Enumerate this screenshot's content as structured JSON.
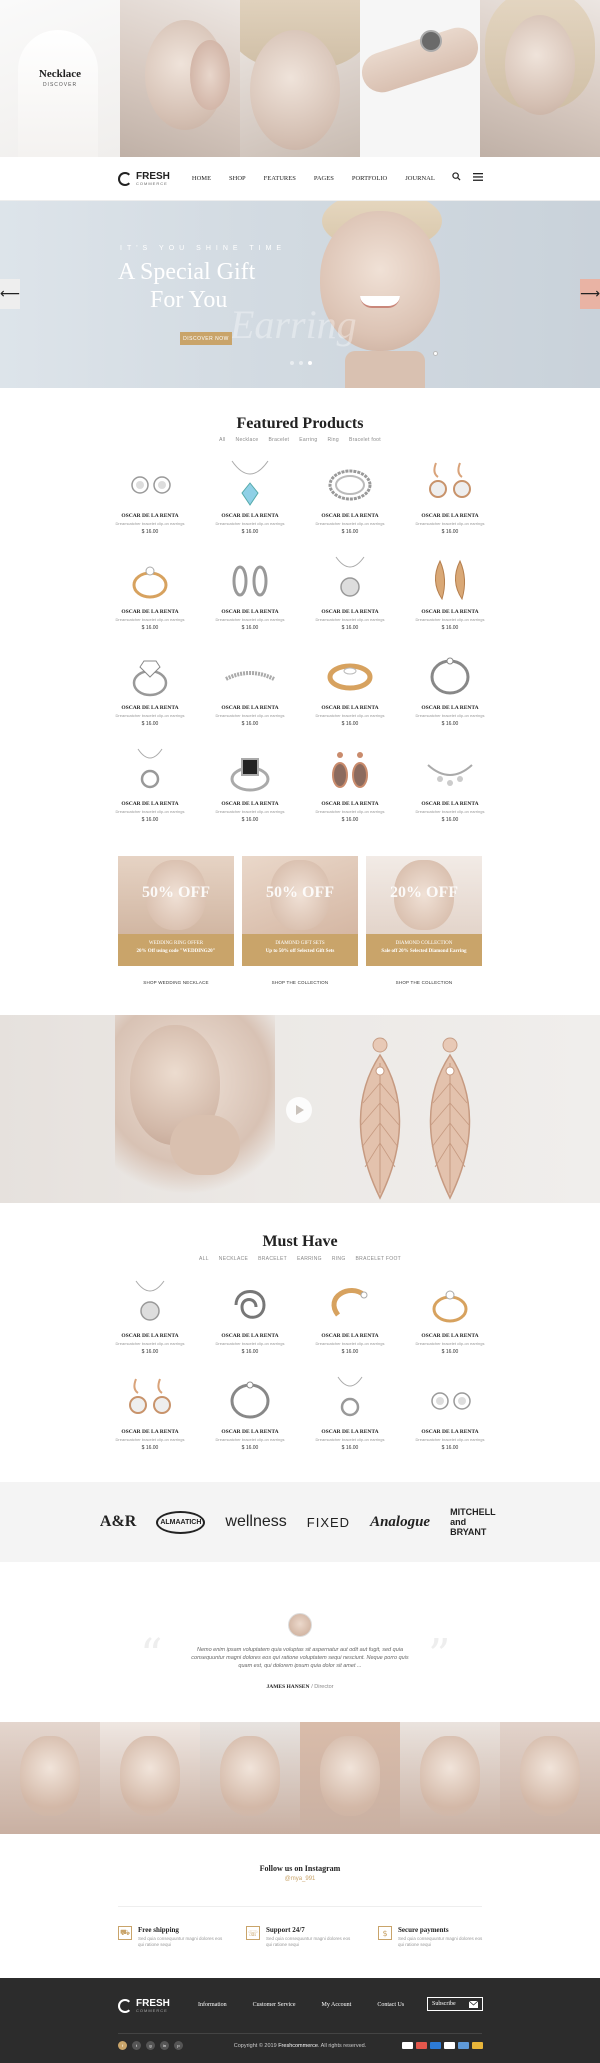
{
  "hero_strip": {
    "caption_title": "Necklace",
    "caption_sub": "DISCOVER"
  },
  "header": {
    "logo_main": "FRESH",
    "logo_sub": "COMMERCE",
    "nav": [
      "HOME",
      "SHOP",
      "FEATURES",
      "PAGES",
      "PORTFOLIO",
      "JOURNAL"
    ]
  },
  "slider": {
    "eyebrow": "IT'S YOU SHINE TIME",
    "title_line1": "A Special Gift",
    "title_line2": "For You",
    "watermark": "Earring",
    "cta": "DISCOVER NOW",
    "prev_arrow": "⟵",
    "next_arrow": "⟶"
  },
  "featured": {
    "title": "Featured Products",
    "tabs": [
      "All",
      "Necklace",
      "Bracelet",
      "Earring",
      "Ring",
      "Bracelet foot"
    ],
    "products": [
      {
        "name": "OSCAR DE LA RENTA",
        "desc": "Dreamcatcher bracelet clip-on earrings",
        "price": "$ 16.00",
        "icon": "stud-earrings-icon"
      },
      {
        "name": "OSCAR DE LA RENTA",
        "desc": "Dreamcatcher bracelet clip-on earrings",
        "price": "$ 16.00",
        "icon": "blue-pendant-icon"
      },
      {
        "name": "OSCAR DE LA RENTA",
        "desc": "Dreamcatcher bracelet clip-on earrings",
        "price": "$ 16.00",
        "icon": "chain-bracelet-icon"
      },
      {
        "name": "OSCAR DE LA RENTA",
        "desc": "Dreamcatcher bracelet clip-on earrings",
        "price": "$ 16.00",
        "icon": "drop-earrings-icon"
      },
      {
        "name": "OSCAR DE LA RENTA",
        "desc": "Dreamcatcher bracelet clip-on earrings",
        "price": "$ 16.00",
        "icon": "gold-ring-icon"
      },
      {
        "name": "OSCAR DE LA RENTA",
        "desc": "Dreamcatcher bracelet clip-on earrings",
        "price": "$ 16.00",
        "icon": "hoop-earrings-icon"
      },
      {
        "name": "OSCAR DE LA RENTA",
        "desc": "Dreamcatcher bracelet clip-on earrings",
        "price": "$ 16.00",
        "icon": "silver-pendant-icon"
      },
      {
        "name": "OSCAR DE LA RENTA",
        "desc": "Dreamcatcher bracelet clip-on earrings",
        "price": "$ 16.00",
        "icon": "leaf-earrings-icon"
      },
      {
        "name": "OSCAR DE LA RENTA",
        "desc": "Dreamcatcher bracelet clip-on earrings",
        "price": "$ 16.00",
        "icon": "diamond-ring-icon"
      },
      {
        "name": "OSCAR DE LA RENTA",
        "desc": "Dreamcatcher bracelet clip-on earrings",
        "price": "$ 16.00",
        "icon": "tennis-bracelet-icon"
      },
      {
        "name": "OSCAR DE LA RENTA",
        "desc": "Dreamcatcher bracelet clip-on earrings",
        "price": "$ 16.00",
        "icon": "gold-band-ring-icon"
      },
      {
        "name": "OSCAR DE LA RENTA",
        "desc": "Dreamcatcher bracelet clip-on earrings",
        "price": "$ 16.00",
        "icon": "bangle-icon"
      },
      {
        "name": "OSCAR DE LA RENTA",
        "desc": "Dreamcatcher bracelet clip-on earrings",
        "price": "$ 16.00",
        "icon": "circle-pendant-icon"
      },
      {
        "name": "OSCAR DE LA RENTA",
        "desc": "Dreamcatcher bracelet clip-on earrings",
        "price": "$ 16.00",
        "icon": "black-stone-ring-icon"
      },
      {
        "name": "OSCAR DE LA RENTA",
        "desc": "Dreamcatcher bracelet clip-on earrings",
        "price": "$ 16.00",
        "icon": "rose-drop-earrings-icon"
      },
      {
        "name": "OSCAR DE LA RENTA",
        "desc": "Dreamcatcher bracelet clip-on earrings",
        "price": "$ 16.00",
        "icon": "charm-bracelet-icon"
      }
    ]
  },
  "banners": [
    {
      "off": "50% OFF",
      "line1": "WEDDING RING OFFER",
      "line2": "20% Off using code \"WEDDING20\"",
      "link": "SHOP WEDDING NECKLACE"
    },
    {
      "off": "50% OFF",
      "line1": "DIAMOND GIFT SETS",
      "line2": "Up to 50% off Selected Gift Sets",
      "link": "SHOP THE COLLECTION"
    },
    {
      "off": "20% OFF",
      "line1": "DIAMOND COLLECTION",
      "line2": "Sale off 20% Selected Diamond Earring",
      "link": "SHOP THE COLLECTION"
    }
  ],
  "must_have": {
    "title": "Must Have",
    "tabs": [
      "ALL",
      "NECKLACE",
      "BRACELET",
      "EARRING",
      "RING",
      "BRACELET FOOT"
    ],
    "products": [
      {
        "name": "OSCAR DE LA RENTA",
        "desc": "Dreamcatcher bracelet clip-on earrings",
        "price": "$ 16.00",
        "icon": "silver-pendant-icon"
      },
      {
        "name": "OSCAR DE LA RENTA",
        "desc": "Dreamcatcher bracelet clip-on earrings",
        "price": "$ 16.00",
        "icon": "swirl-ring-icon"
      },
      {
        "name": "OSCAR DE LA RENTA",
        "desc": "Dreamcatcher bracelet clip-on earrings",
        "price": "$ 16.00",
        "icon": "open-ring-icon"
      },
      {
        "name": "OSCAR DE LA RENTA",
        "desc": "Dreamcatcher bracelet clip-on earrings",
        "price": "$ 16.00",
        "icon": "gold-ring-icon"
      },
      {
        "name": "OSCAR DE LA RENTA",
        "desc": "Dreamcatcher bracelet clip-on earrings",
        "price": "$ 16.00",
        "icon": "drop-earrings-icon"
      },
      {
        "name": "OSCAR DE LA RENTA",
        "desc": "Dreamcatcher bracelet clip-on earrings",
        "price": "$ 16.00",
        "icon": "bangle-icon"
      },
      {
        "name": "OSCAR DE LA RENTA",
        "desc": "Dreamcatcher bracelet clip-on earrings",
        "price": "$ 16.00",
        "icon": "circle-pendant-icon"
      },
      {
        "name": "OSCAR DE LA RENTA",
        "desc": "Dreamcatcher bracelet clip-on earrings",
        "price": "$ 16.00",
        "icon": "stud-earrings-icon"
      }
    ]
  },
  "brands": [
    "A&R",
    "ALMAATICH",
    "wellness",
    "FIXED",
    "Analogue",
    "MITCHELL and BRYANT"
  ],
  "testimonial": {
    "text": "Nemo enim ipsam voluptatem quia voluptas sit aspernatur aut odit aut fugit, sed quia consequuntur magni dolores eos qui ratione voluptatem sequi nesciunt. Neque porro quis quam est, qui dolorem ipsum quia dolor sit amet ...",
    "author": "JAMES HANSEN",
    "role": "/ Director"
  },
  "instagram": {
    "title": "Follow us on Instagram",
    "handle": "@mya_991"
  },
  "features": [
    {
      "icon": "truck-icon",
      "title": "Free shipping",
      "desc": "Sed quia consequuntur magni dolores eos qui ratione sequi"
    },
    {
      "icon": "support-icon",
      "title": "Support 24/7",
      "desc": "Sed quia consequuntur magni dolores eos qui ratione sequi"
    },
    {
      "icon": "payment-icon",
      "title": "Secure payments",
      "desc": "Sed quia consequuntur magni dolores eos qui ratione sequi"
    }
  ],
  "footer": {
    "logo_main": "FRESH",
    "logo_sub": "COMMERCE",
    "nav": [
      "Information",
      "Customer Service",
      "My Account",
      "Contact Us"
    ],
    "subscribe": "Subscribe",
    "copyright_prefix": "Copyright © 2019 ",
    "copyright_brand": "Freshcommerce",
    "copyright_suffix": ". All rights reserved.",
    "social": [
      "f",
      "t",
      "g",
      "in",
      "p"
    ]
  },
  "colors": {
    "accent": "#c9a46a",
    "footer_bg": "#2c2c2c",
    "slider_bg": "#d6dee5"
  }
}
